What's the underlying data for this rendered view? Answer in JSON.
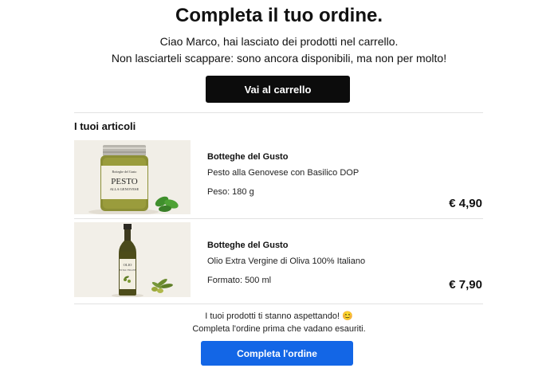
{
  "header": {
    "title": "Completa il tuo ordine.",
    "line1": "Ciao Marco, hai lasciato dei prodotti nel carrello.",
    "line2": "Non lasciarteli scappare: sono ancora disponibili, ma non per molto!",
    "cart_button": "Vai al carrello"
  },
  "items_section": {
    "title": "I tuoi articoli",
    "items": [
      {
        "brand": "Botteghe del Gusto",
        "name": "Pesto alla Genovese con Basilico DOP",
        "meta": "Peso: 180 g",
        "price": "€ 4,90",
        "image_icon": "pesto-jar-image",
        "label_brand": "Botteghe del Gusto",
        "label_line1": "PESTO",
        "label_line2": "ALLA GENOVESE"
      },
      {
        "brand": "Botteghe del Gusto",
        "name": "Olio Extra Vergine di Oliva 100% Italiano",
        "meta": "Formato: 500 ml",
        "price": "€ 7,90",
        "image_icon": "olive-oil-bottle-image",
        "label_line1": "OLIO",
        "label_line2": "EXTRA VERGINE"
      }
    ]
  },
  "footer": {
    "line1": "I tuoi prodotti ti stanno aspettando! 😊",
    "line2": "Completa l'ordine prima che vadano esauriti.",
    "complete_button": "Completa l'ordine"
  },
  "colors": {
    "primary_blue": "#1366e6",
    "dark_button": "#0c0c0c",
    "divider": "#e2e2e2"
  }
}
